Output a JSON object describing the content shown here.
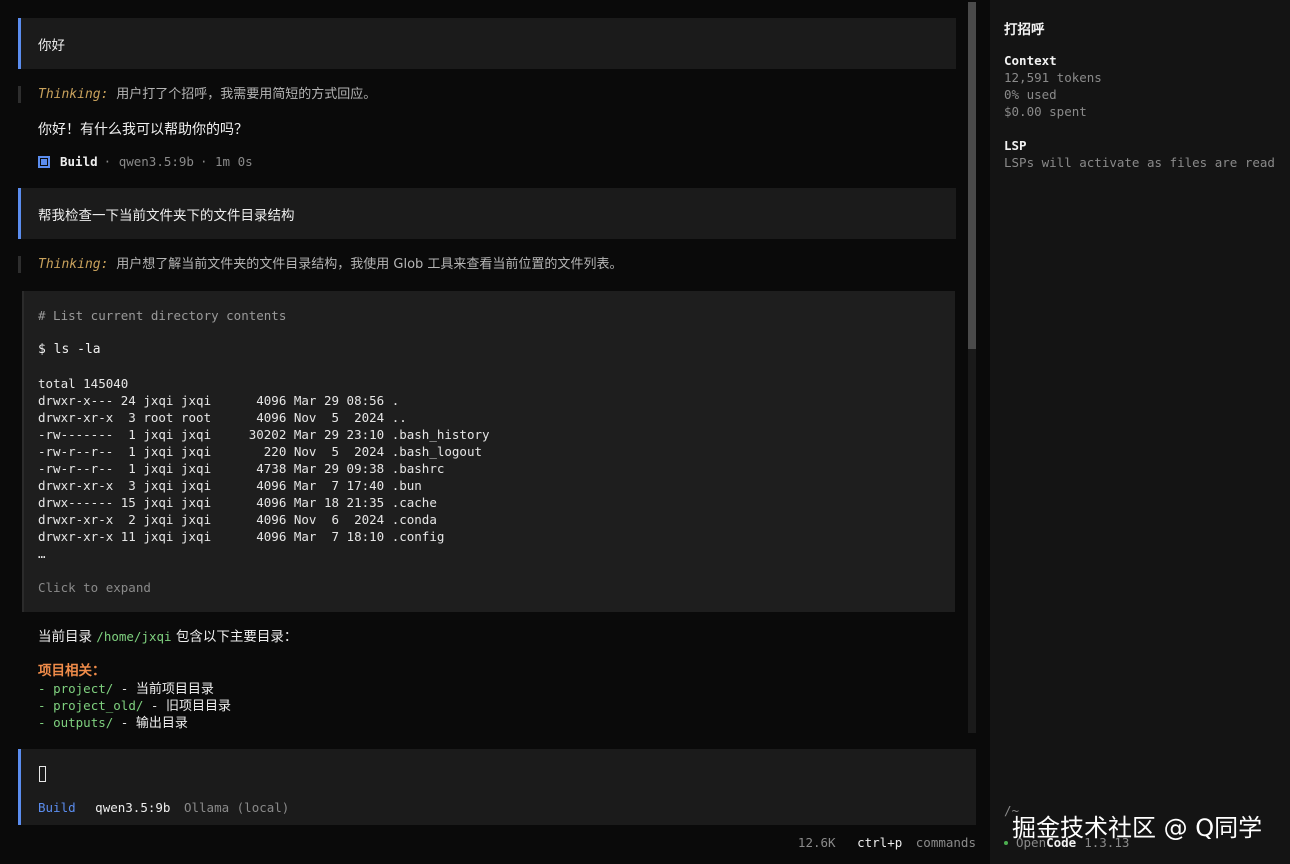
{
  "conversation": {
    "msg1": {
      "user": "你好"
    },
    "think1": {
      "label": "Thinking:",
      "text": "用户打了个招呼，我需要用简短的方式回应。"
    },
    "reply1": "你好！有什么我可以帮助你的吗？",
    "meta1": {
      "agent": "Build",
      "model": "· qwen3.5:9b",
      "duration": "· 1m 0s"
    },
    "msg2": {
      "user": "帮我检查一下当前文件夹下的文件目录结构"
    },
    "think2": {
      "label": "Thinking:",
      "text": "用户想了解当前文件夹的文件目录结构，我使用 Glob 工具来查看当前位置的文件列表。"
    },
    "tool": {
      "comment": "# List current directory contents",
      "command": "$ ls -la",
      "output": [
        "total 145040",
        "drwxr-x--- 24 jxqi jxqi      4096 Mar 29 08:56 .",
        "drwxr-xr-x  3 root root      4096 Nov  5  2024 ..",
        "-rw-------  1 jxqi jxqi     30202 Mar 29 23:10 .bash_history",
        "-rw-r--r--  1 jxqi jxqi       220 Nov  5  2024 .bash_logout",
        "-rw-r--r--  1 jxqi jxqi      4738 Mar 29 09:38 .bashrc",
        "drwxr-xr-x  3 jxqi jxqi      4096 Mar  7 17:40 .bun",
        "drwx------ 15 jxqi jxqi      4096 Mar 18 21:35 .cache",
        "drwxr-xr-x  2 jxqi jxqi      4096 Nov  6  2024 .conda",
        "drwxr-xr-x 11 jxqi jxqi      4096 Mar  7 18:10 .config",
        "…"
      ],
      "expand": "Click to expand"
    },
    "answer": {
      "intro_before": "当前目录 ",
      "intro_path": "/home/jxqi",
      "intro_after": " 包含以下主要目录：",
      "section_title": "项目相关：",
      "items": [
        {
          "dash": "- ",
          "dir": "project/",
          "sep": " - ",
          "desc": "当前项目目录"
        },
        {
          "dash": "- ",
          "dir": "project_old/",
          "sep": " - ",
          "desc": "旧项目目录"
        },
        {
          "dash": "- ",
          "dir": "outputs/",
          "sep": " - ",
          "desc": "输出目录"
        }
      ]
    }
  },
  "input": {
    "agent": "Build",
    "model": "qwen3.5:9b",
    "provider": "Ollama (local)"
  },
  "status_bar": {
    "tokens": "12.6K",
    "shortcut": "ctrl+p",
    "shortcut_label": "commands"
  },
  "sidebar": {
    "title": "打招呼",
    "context": {
      "heading": "Context",
      "tokens": "12,591 tokens",
      "used": "0% used",
      "spent": "$0.00 spent"
    },
    "lsp": {
      "heading": "LSP",
      "message": "LSPs will activate as files are read"
    },
    "path": "/~",
    "app_name_a": "Open",
    "app_name_b": "Code",
    "version": "1.3.13"
  },
  "watermark": "掘金技术社区 @ Q同学",
  "colors": {
    "accent": "#5b8def",
    "path_green": "#7fd17f",
    "section_orange": "#f08c4a",
    "thinking_label": "#c9a25c",
    "status_dot": "#4caf50"
  }
}
